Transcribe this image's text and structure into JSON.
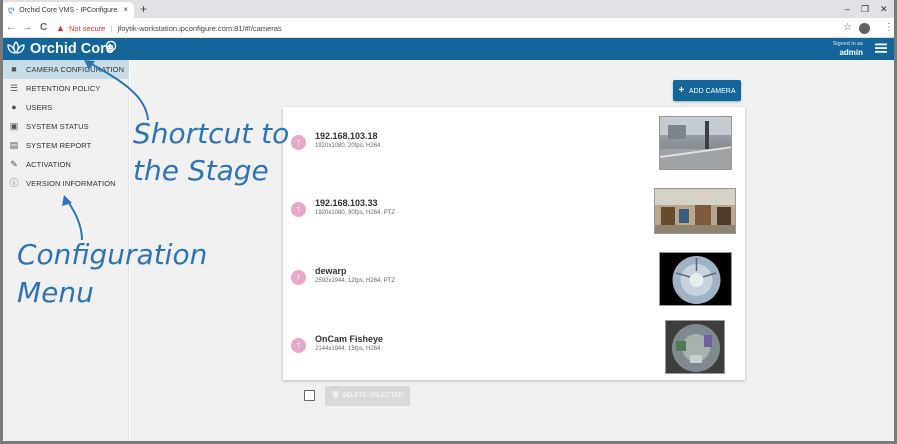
{
  "browser": {
    "tab_title": "Orchid Core VMS - IPConfigure",
    "tab_close": "×",
    "new_tab": "+",
    "window_controls": [
      "–",
      "❐",
      "✕"
    ],
    "back": "←",
    "forward": "→",
    "reload": "C",
    "security_label": "Not secure",
    "url": "jfoytik-workstation.ipconfigure.com:81/#!/cameras",
    "bookmark": "☆",
    "more": "⋮"
  },
  "app": {
    "title": "Orchid Core",
    "signed_in_label": "Signed in as",
    "user": "admin",
    "colors": {
      "header": "#13659a",
      "accent": "#13659a",
      "sidebar_active": "#c9dde9"
    }
  },
  "sidebar": {
    "items": [
      {
        "label": "CAMERA CONFIGURATION",
        "icon": "video-camera-icon",
        "active": true
      },
      {
        "label": "RETENTION POLICY",
        "icon": "database-icon"
      },
      {
        "label": "USERS",
        "icon": "user-icon"
      },
      {
        "label": "SYSTEM STATUS",
        "icon": "system-status-icon"
      },
      {
        "label": "SYSTEM REPORT",
        "icon": "system-report-icon"
      },
      {
        "label": "ACTIVATION",
        "icon": "plug-icon"
      },
      {
        "label": "VERSION INFORMATION",
        "icon": "info-icon"
      }
    ]
  },
  "main": {
    "add_camera_label": "ADD CAMERA",
    "delete_selected_label": "DELETE SELECTED",
    "cameras": [
      {
        "name": "192.168.103.18",
        "meta": "1920x1080, 20fps, H264"
      },
      {
        "name": "192.168.103.33",
        "meta": "1920x1080, 30fps, H264, PTZ"
      },
      {
        "name": "dewarp",
        "meta": "2592x1944, 12fps, H264, PTZ"
      },
      {
        "name": "OnCam Fisheye",
        "meta": "2144x1944, 15fps, H264"
      }
    ]
  },
  "annotations": {
    "shortcut_line1": "Shortcut to",
    "shortcut_line2": "the Stage",
    "config_line1": "Configuration",
    "config_line2": "Menu",
    "color": "#2e74b5"
  }
}
